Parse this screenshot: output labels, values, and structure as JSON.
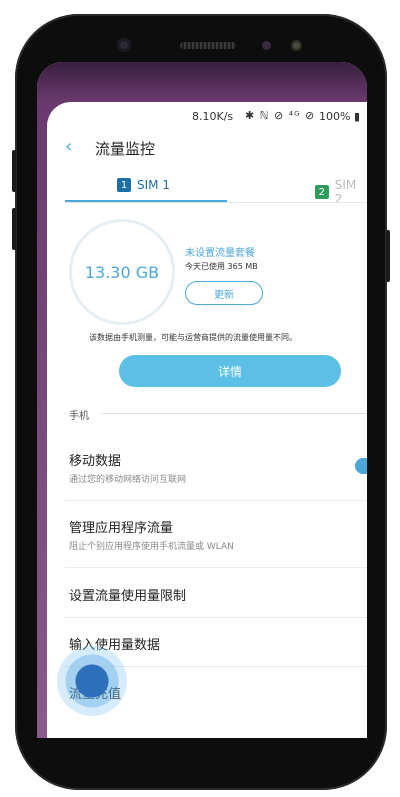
{
  "status_bar": {
    "speed": "8.10K/s",
    "icons": "✱ ℕ ⊘ ⁴ᴳ ⊘",
    "battery": "100% ▮"
  },
  "header": {
    "back_icon": "chevron-left",
    "title": "流量监控"
  },
  "tabs": [
    {
      "num": "1",
      "label": "SIM 1",
      "color": "#1c6fa6"
    },
    {
      "num": "2",
      "label": "SIM 2",
      "color": "#2f9b5d"
    }
  ],
  "usage": {
    "amount": "13.30 GB",
    "plan_warning": "未设置流量套餐",
    "today_used": "今天已使用 365 MB",
    "update_button": "更新",
    "note": "该数据由手机测量，可能与运营商提供的流量使用量不同。",
    "detail_button": "详情"
  },
  "section": {
    "label": "手机"
  },
  "rows": [
    {
      "title": "移动数据",
      "subtitle": "通过您的移动网络访问互联网"
    },
    {
      "title": "管理应用程序流量",
      "subtitle": "阻止个别应用程序使用手机流量或 WLAN"
    },
    {
      "title": "设置流量使用量限制",
      "subtitle": ""
    },
    {
      "title": "输入使用量数据",
      "subtitle": ""
    },
    {
      "title": "流量充值",
      "subtitle": ""
    }
  ],
  "colors": {
    "accent": "#4aa7d8",
    "accent_button": "#5bbfe6"
  }
}
